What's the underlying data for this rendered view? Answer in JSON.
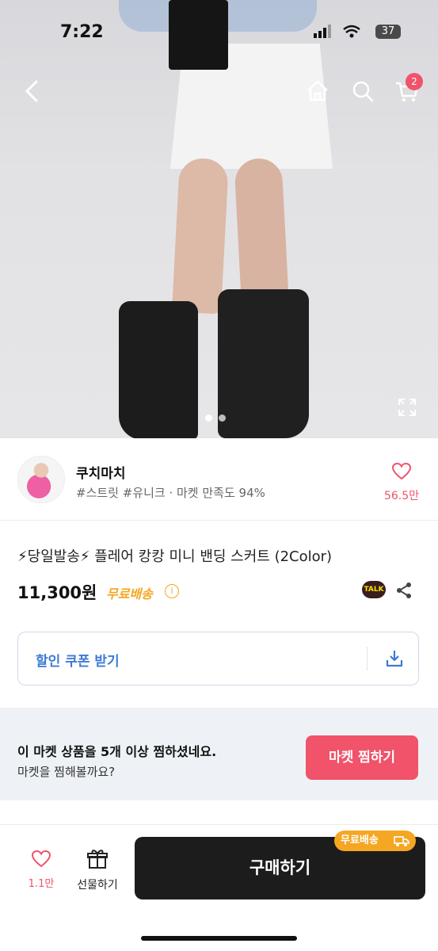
{
  "status": {
    "time": "7:22",
    "battery": "37"
  },
  "nav": {
    "cart_count": "2"
  },
  "store": {
    "name": "쿠치마치",
    "tags": "#스트릿 #유니크 · 마켓 만족도 94%",
    "likes": "56.5만"
  },
  "product": {
    "title": "⚡당일발송⚡ 플레어 캉캉 미니 밴딩 스커트 (2Color)",
    "price": "11,300원",
    "shipping": "무료배송",
    "talk_label": "TALK"
  },
  "coupon": {
    "label": "할인 쿠폰 받기"
  },
  "banner": {
    "main": "이 마켓 상품을 5개 이상 찜하셨네요.",
    "sub": "마켓을 찜해볼까요?",
    "button": "마켓 찜하기"
  },
  "bottom": {
    "likes": "1.1만",
    "gift_label": "선물하기",
    "buy_label": "구매하기",
    "buy_badge": "무료배송"
  },
  "icons": [
    "back-icon",
    "home-icon",
    "search-icon",
    "cart-icon",
    "expand-icon",
    "heart-icon",
    "info-icon",
    "kakaotalk-icon",
    "share-icon",
    "download-icon",
    "gift-icon",
    "truck-icon"
  ],
  "colors": {
    "accent": "#f0536a",
    "link": "#3d7ad6",
    "shipping": "#f5a623",
    "banner_bg": "#eef2f7",
    "buy_bg": "#1c1c1c"
  },
  "carousel": {
    "count": 2,
    "active": 1
  }
}
